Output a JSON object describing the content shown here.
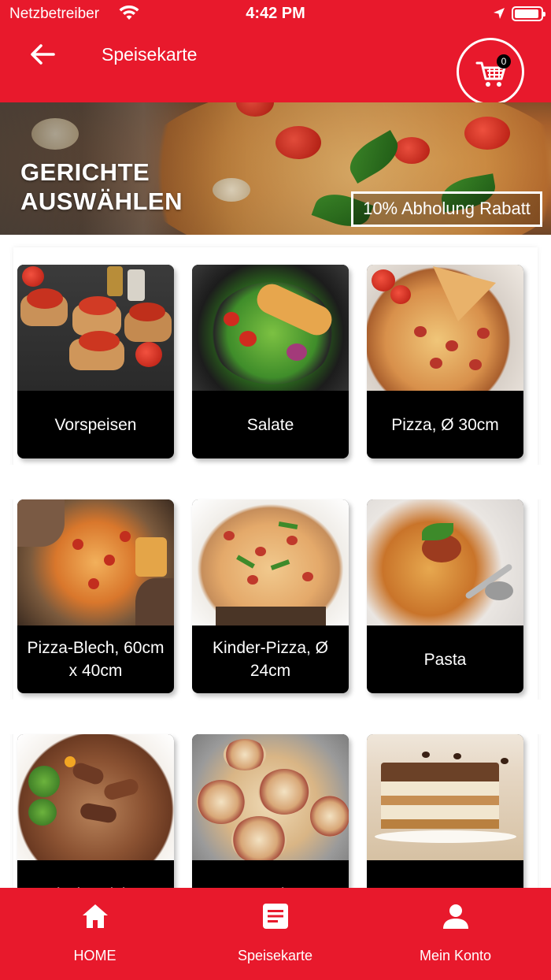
{
  "status_bar": {
    "carrier": "Netzbetreiber",
    "time": "4:42 PM"
  },
  "header": {
    "title": "Speisekarte",
    "cart_count": "0"
  },
  "hero": {
    "title_line1": "GERICHTE",
    "title_line2": "AUSWÄHLEN",
    "discount": "10% Abholung Rabatt"
  },
  "categories": [
    {
      "label": "Vorspeisen",
      "image": "bruschetta"
    },
    {
      "label": "Salate",
      "image": "chicken-salad"
    },
    {
      "label": "Pizza, Ø 30cm",
      "image": "pizza"
    },
    {
      "label": "Pizza-Blech, 60cm x 40cm",
      "image": "sheet-pizza"
    },
    {
      "label": "Kinder-Pizza, Ø 24cm",
      "image": "kids-pizza"
    },
    {
      "label": "Pasta",
      "image": "spaghetti"
    },
    {
      "label": "Fischgerichte",
      "image": "calamari"
    },
    {
      "label": "Snacks",
      "image": "pizza-rolls"
    },
    {
      "label": "Desserts",
      "image": "tiramisu"
    }
  ],
  "bottom_nav": [
    {
      "label": "HOME",
      "icon": "home-icon"
    },
    {
      "label": "Speisekarte",
      "icon": "menu-icon"
    },
    {
      "label": "Mein Konto",
      "icon": "user-icon"
    }
  ],
  "colors": {
    "brand_red": "#e8192c",
    "card_label_bg": "#000000",
    "text_on_brand": "#ffffff"
  }
}
